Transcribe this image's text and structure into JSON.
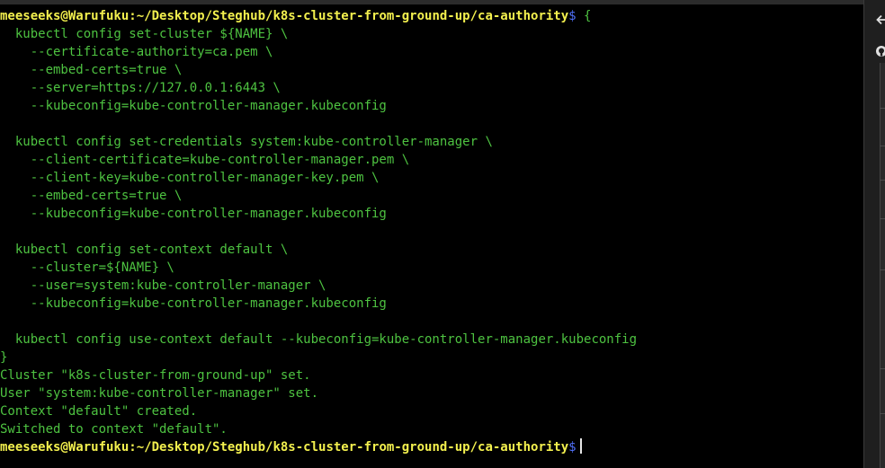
{
  "terminal": {
    "lines": [
      {
        "kind": "prompt",
        "user_host": "meeseeks@Warufuku",
        "path": ":~/Desktop/Steghub/k8s-cluster-from-ground-up/ca-authority",
        "symbol": "$",
        "command": " {"
      },
      {
        "kind": "text",
        "text": "  kubectl config set-cluster ${NAME} \\"
      },
      {
        "kind": "text",
        "text": "    --certificate-authority=ca.pem \\"
      },
      {
        "kind": "text",
        "text": "    --embed-certs=true \\"
      },
      {
        "kind": "text",
        "text": "    --server=https://127.0.0.1:6443 \\"
      },
      {
        "kind": "text",
        "text": "    --kubeconfig=kube-controller-manager.kubeconfig"
      },
      {
        "kind": "text",
        "text": ""
      },
      {
        "kind": "text",
        "text": "  kubectl config set-credentials system:kube-controller-manager \\"
      },
      {
        "kind": "text",
        "text": "    --client-certificate=kube-controller-manager.pem \\"
      },
      {
        "kind": "text",
        "text": "    --client-key=kube-controller-manager-key.pem \\"
      },
      {
        "kind": "text",
        "text": "    --embed-certs=true \\"
      },
      {
        "kind": "text",
        "text": "    --kubeconfig=kube-controller-manager.kubeconfig"
      },
      {
        "kind": "text",
        "text": ""
      },
      {
        "kind": "text",
        "text": "  kubectl config set-context default \\"
      },
      {
        "kind": "text",
        "text": "    --cluster=${NAME} \\"
      },
      {
        "kind": "text",
        "text": "    --user=system:kube-controller-manager \\"
      },
      {
        "kind": "text",
        "text": "    --kubeconfig=kube-controller-manager.kubeconfig"
      },
      {
        "kind": "text",
        "text": ""
      },
      {
        "kind": "text",
        "text": "  kubectl config use-context default --kubeconfig=kube-controller-manager.kubeconfig"
      },
      {
        "kind": "text",
        "text": "}"
      },
      {
        "kind": "text",
        "text": "Cluster \"k8s-cluster-from-ground-up\" set."
      },
      {
        "kind": "text",
        "text": "User \"system:kube-controller-manager\" set."
      },
      {
        "kind": "text",
        "text": "Context \"default\" created."
      },
      {
        "kind": "text",
        "text": "Switched to context \"default\"."
      },
      {
        "kind": "prompt",
        "user_host": "meeseeks@Warufuku",
        "path": ":~/Desktop/Steghub/k8s-cluster-from-ground-up/ca-authority",
        "symbol": "$",
        "command": "",
        "cursor": true
      }
    ]
  },
  "right_panel": {
    "icons": [
      "arrow-left-icon",
      "github-icon"
    ]
  },
  "colors": {
    "background": "#000000",
    "prompt": "#f3f04e",
    "dollar": "#4f6ff7",
    "output": "#4ec341",
    "cursor": "#e6e6e6"
  }
}
